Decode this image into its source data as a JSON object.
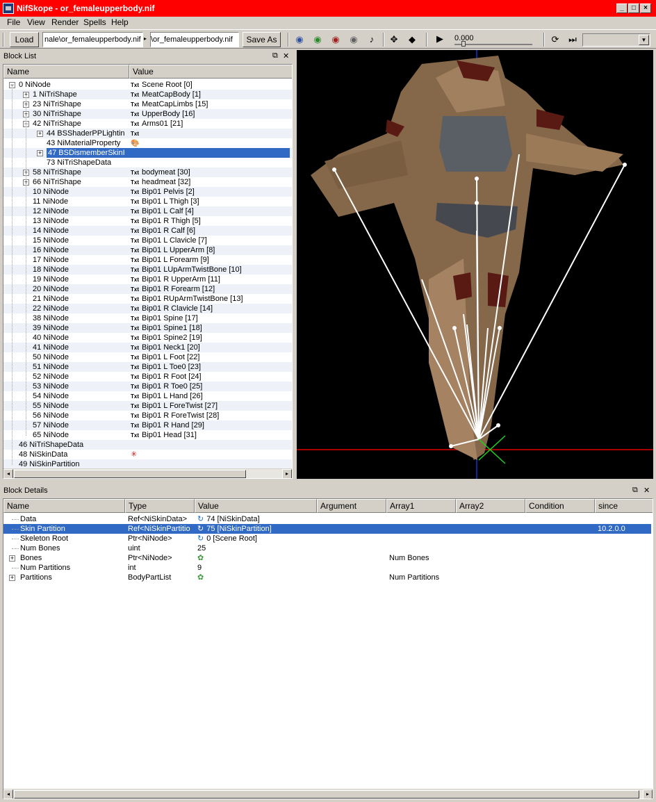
{
  "window": {
    "title": "NifSkope - or_femaleupperbody.nif"
  },
  "menu": [
    "File",
    "View",
    "Render",
    "Spells",
    "Help"
  ],
  "toolbar": {
    "load": "Load",
    "path1": "nale\\or_femaleupperbody.nif",
    "path2": "\\or_femaleupperbody.nif",
    "save_as": "Save As",
    "time": "0.000"
  },
  "block_list": {
    "title": "Block List",
    "columns": [
      "Name",
      "Value"
    ],
    "rows": [
      {
        "depth": 0,
        "toggle": "minus",
        "name": "0  NiNode",
        "txt": true,
        "value": "Scene Root [0]"
      },
      {
        "depth": 1,
        "toggle": "plus",
        "name": "1  NiTriShape",
        "txt": true,
        "value": "MeatCapBody [1]"
      },
      {
        "depth": 1,
        "toggle": "plus",
        "name": "23  NiTriShape",
        "txt": true,
        "value": "MeatCapLimbs [15]"
      },
      {
        "depth": 1,
        "toggle": "plus",
        "name": "30  NiTriShape",
        "txt": true,
        "value": "UpperBody [16]"
      },
      {
        "depth": 1,
        "toggle": "minus",
        "name": "42  NiTriShape",
        "txt": true,
        "value": "Arms01 [21]"
      },
      {
        "depth": 2,
        "toggle": "plus",
        "name": "44  BSShaderPPLightin",
        "txt": true,
        "value": ""
      },
      {
        "depth": 2,
        "toggle": "",
        "name": "43  NiMaterialProperty",
        "icon": "palette",
        "value": ""
      },
      {
        "depth": 2,
        "toggle": "plus",
        "name": "47  BSDismemberSkinI",
        "value": "",
        "selected": true
      },
      {
        "depth": 2,
        "toggle": "",
        "name": "73  NiTriShapeData",
        "value": ""
      },
      {
        "depth": 1,
        "toggle": "plus",
        "name": "58  NiTriShape",
        "txt": true,
        "value": "bodymeat [30]"
      },
      {
        "depth": 1,
        "toggle": "plus",
        "name": "66  NiTriShape",
        "txt": true,
        "value": "headmeat [32]"
      },
      {
        "depth": 1,
        "toggle": "",
        "name": "10  NiNode",
        "txt": true,
        "value": "Bip01 Pelvis [2]"
      },
      {
        "depth": 1,
        "toggle": "",
        "name": "11  NiNode",
        "txt": true,
        "value": "Bip01 L Thigh [3]"
      },
      {
        "depth": 1,
        "toggle": "",
        "name": "12  NiNode",
        "txt": true,
        "value": "Bip01 L Calf [4]"
      },
      {
        "depth": 1,
        "toggle": "",
        "name": "13  NiNode",
        "txt": true,
        "value": "Bip01 R Thigh [5]"
      },
      {
        "depth": 1,
        "toggle": "",
        "name": "14  NiNode",
        "txt": true,
        "value": "Bip01 R Calf [6]"
      },
      {
        "depth": 1,
        "toggle": "",
        "name": "15  NiNode",
        "txt": true,
        "value": "Bip01 L Clavicle [7]"
      },
      {
        "depth": 1,
        "toggle": "",
        "name": "16  NiNode",
        "txt": true,
        "value": "Bip01 L UpperArm [8]"
      },
      {
        "depth": 1,
        "toggle": "",
        "name": "17  NiNode",
        "txt": true,
        "value": "Bip01 L Forearm [9]"
      },
      {
        "depth": 1,
        "toggle": "",
        "name": "18  NiNode",
        "txt": true,
        "value": "Bip01 LUpArmTwistBone [10]"
      },
      {
        "depth": 1,
        "toggle": "",
        "name": "19  NiNode",
        "txt": true,
        "value": "Bip01 R UpperArm [11]"
      },
      {
        "depth": 1,
        "toggle": "",
        "name": "20  NiNode",
        "txt": true,
        "value": "Bip01 R Forearm [12]"
      },
      {
        "depth": 1,
        "toggle": "",
        "name": "21  NiNode",
        "txt": true,
        "value": "Bip01 RUpArmTwistBone [13]"
      },
      {
        "depth": 1,
        "toggle": "",
        "name": "22  NiNode",
        "txt": true,
        "value": "Bip01 R Clavicle [14]"
      },
      {
        "depth": 1,
        "toggle": "",
        "name": "38  NiNode",
        "txt": true,
        "value": "Bip01 Spine [17]"
      },
      {
        "depth": 1,
        "toggle": "",
        "name": "39  NiNode",
        "txt": true,
        "value": "Bip01 Spine1 [18]"
      },
      {
        "depth": 1,
        "toggle": "",
        "name": "40  NiNode",
        "txt": true,
        "value": "Bip01 Spine2 [19]"
      },
      {
        "depth": 1,
        "toggle": "",
        "name": "41  NiNode",
        "txt": true,
        "value": "Bip01 Neck1 [20]"
      },
      {
        "depth": 1,
        "toggle": "",
        "name": "50  NiNode",
        "txt": true,
        "value": "Bip01 L Foot [22]"
      },
      {
        "depth": 1,
        "toggle": "",
        "name": "51  NiNode",
        "txt": true,
        "value": "Bip01 L Toe0 [23]"
      },
      {
        "depth": 1,
        "toggle": "",
        "name": "52  NiNode",
        "txt": true,
        "value": "Bip01 R Foot [24]"
      },
      {
        "depth": 1,
        "toggle": "",
        "name": "53  NiNode",
        "txt": true,
        "value": "Bip01 R Toe0 [25]"
      },
      {
        "depth": 1,
        "toggle": "",
        "name": "54  NiNode",
        "txt": true,
        "value": "Bip01 L Hand [26]"
      },
      {
        "depth": 1,
        "toggle": "",
        "name": "55  NiNode",
        "txt": true,
        "value": "Bip01 L ForeTwist [27]"
      },
      {
        "depth": 1,
        "toggle": "",
        "name": "56  NiNode",
        "txt": true,
        "value": "Bip01 R ForeTwist [28]"
      },
      {
        "depth": 1,
        "toggle": "",
        "name": "57  NiNode",
        "txt": true,
        "value": "Bip01 R Hand [29]"
      },
      {
        "depth": 1,
        "toggle": "",
        "name": "65  NiNode",
        "txt": true,
        "value": "Bip01 Head [31]"
      },
      {
        "depth": 0,
        "toggle": "",
        "name": "46  NiTriShapeData",
        "value": ""
      },
      {
        "depth": 0,
        "toggle": "",
        "name": "48  NiSkinData",
        "icon": "axes",
        "value": ""
      },
      {
        "depth": 0,
        "toggle": "",
        "name": "49  NiSkinPartition",
        "value": ""
      }
    ]
  },
  "block_details": {
    "title": "Block Details",
    "columns": [
      "Name",
      "Type",
      "Value",
      "Argument",
      "Array1",
      "Array2",
      "Condition",
      "since"
    ],
    "rows": [
      {
        "toggle": "",
        "name": "Data",
        "type": "Ref<NiSkinData>",
        "icon": "link",
        "value": "74 [NiSkinData]",
        "argument": "",
        "array1": "",
        "since": ""
      },
      {
        "toggle": "",
        "name": "Skin Partition",
        "type": "Ref<NiSkinPartitio",
        "icon": "link",
        "value": "75 [NiSkinPartition]",
        "argument": "",
        "array1": "",
        "since": "10.2.0.0",
        "selected": true
      },
      {
        "toggle": "",
        "name": "Skeleton Root",
        "type": "Ptr<NiNode>",
        "icon": "link",
        "value": "0 [Scene Root]",
        "argument": "",
        "array1": "",
        "since": ""
      },
      {
        "toggle": "",
        "name": "Num Bones",
        "type": "uint",
        "icon": "",
        "value": "25",
        "argument": "",
        "array1": "",
        "since": ""
      },
      {
        "toggle": "plus",
        "name": "Bones",
        "type": "Ptr<NiNode>",
        "icon": "feet",
        "value": "",
        "argument": "",
        "array1": "Num Bones",
        "since": ""
      },
      {
        "toggle": "",
        "name": "Num Partitions",
        "type": "int",
        "icon": "",
        "value": "9",
        "argument": "",
        "array1": "",
        "since": ""
      },
      {
        "toggle": "plus",
        "name": "Partitions",
        "type": "BodyPartList",
        "icon": "feet",
        "value": "",
        "argument": "",
        "array1": "Num Partitions",
        "since": ""
      }
    ]
  }
}
